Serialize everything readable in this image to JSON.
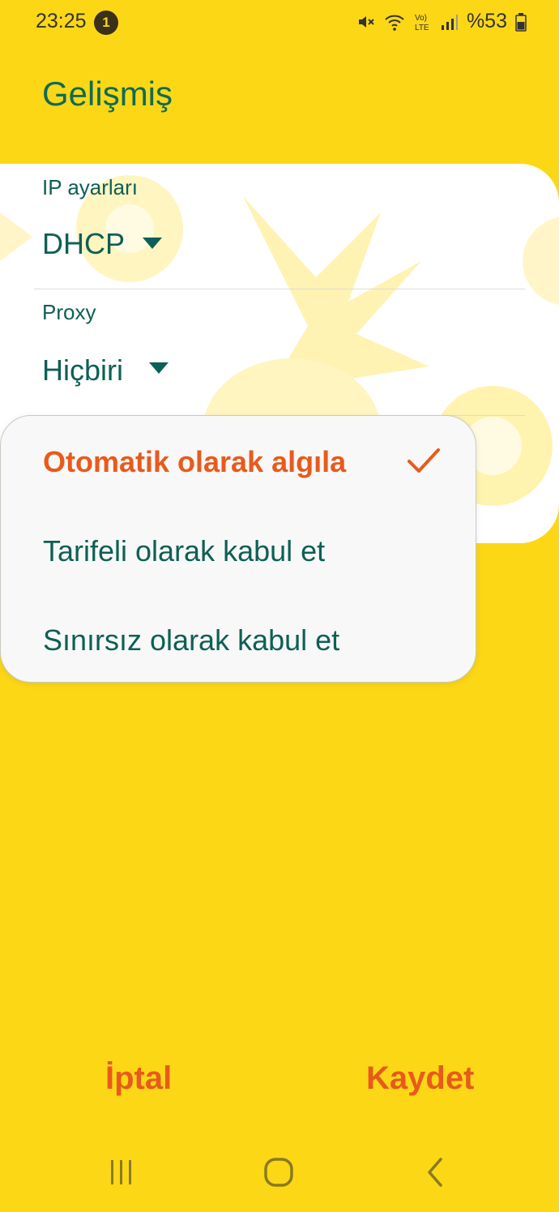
{
  "status_bar": {
    "time": "23:25",
    "notification_count": "1",
    "volte": "Vo)\nLTE",
    "battery": "%53"
  },
  "header": {
    "title": "Gelişmiş"
  },
  "ip_settings": {
    "label": "IP ayarları",
    "value": "DHCP"
  },
  "proxy": {
    "label": "Proxy",
    "value": "Hiçbiri"
  },
  "metered_menu": {
    "options": [
      {
        "label": "Otomatik olarak algıla",
        "selected": true
      },
      {
        "label": "Tarifeli olarak kabul et",
        "selected": false
      },
      {
        "label": "Sınırsız olarak kabul et",
        "selected": false
      }
    ]
  },
  "actions": {
    "cancel": "İptal",
    "save": "Kaydet"
  },
  "colors": {
    "background": "#FCD716",
    "accent": "#E85A1C",
    "text": "#0E5F55",
    "title": "#0E6B57"
  },
  "icons": [
    "mute-icon",
    "wifi-icon",
    "volte-icon",
    "signal-icon",
    "battery-icon",
    "checkmark-icon",
    "recent-apps-icon",
    "home-icon",
    "back-icon"
  ]
}
